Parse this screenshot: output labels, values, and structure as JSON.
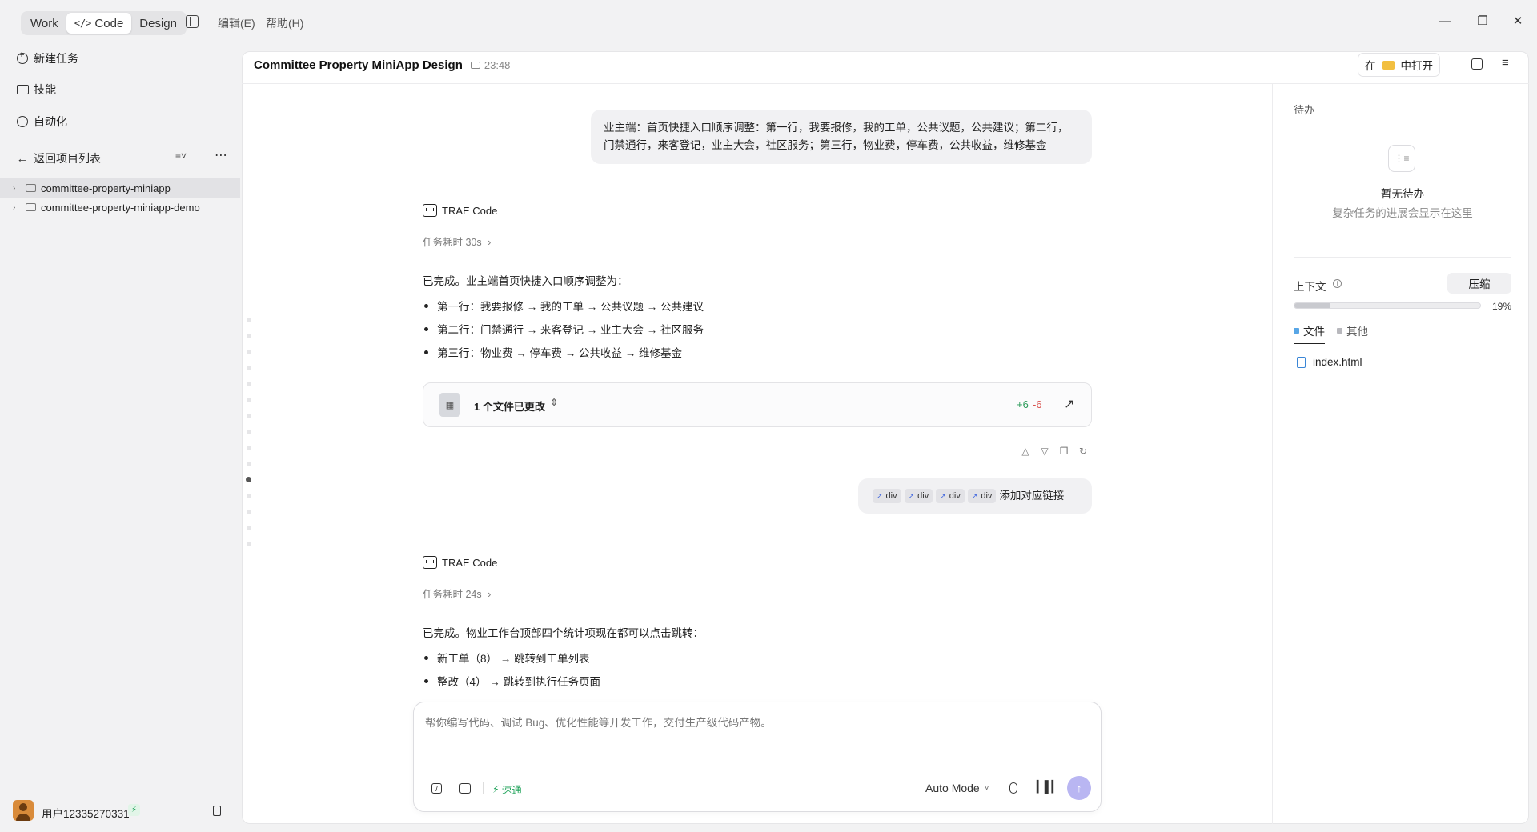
{
  "topbar": {
    "modes": [
      {
        "label": "Work",
        "active": false
      },
      {
        "label": "Code",
        "active": true
      },
      {
        "label": "Design",
        "active": false
      }
    ],
    "menus": [
      "编辑(E)",
      "帮助(H)"
    ]
  },
  "sidebar": {
    "nav": [
      {
        "label": "新建任务",
        "icon": "new-task-icon"
      },
      {
        "label": "技能",
        "icon": "book-icon"
      },
      {
        "label": "自动化",
        "icon": "clock-icon"
      }
    ],
    "back_label": "返回项目列表",
    "projects": [
      {
        "name": "committee-property-miniapp",
        "selected": true
      },
      {
        "name": "committee-property-miniapp-demo",
        "selected": false
      }
    ],
    "user": {
      "name": "用户12335270331",
      "badge": "⚡"
    }
  },
  "header": {
    "title": "Committee Property MiniApp Design",
    "time": "23:48",
    "open_in": {
      "prefix": "在",
      "suffix": "中打开"
    }
  },
  "chat": {
    "msg1": {
      "line1": "业主端：首页快捷入口顺序调整：第一行，我要报修，我的工单，公共议题，公共建议；第二行，",
      "line2": "门禁通行，来客登记，业主大会，社区服务；第三行，物业费，停车费，公共收益，维修基金"
    },
    "reply1": {
      "agent": "TRAE Code",
      "task_time": "任务耗时 30s",
      "summary": "已完成。业主端首页快捷入口顺序调整为：",
      "bullets": [
        "第一行：我要报修 → 我的工单 → 公共议题 → 公共建议",
        "第二行：门禁通行 → 来客登记 → 业主大会 → 社区服务",
        "第三行：物业费 → 停车费 → 公共收益 → 维修基金"
      ],
      "file_change": {
        "label": "1 个文件已更改",
        "added": "+6",
        "removed": "-6"
      }
    },
    "msg2": {
      "chips": [
        "div",
        "div",
        "div",
        "div"
      ],
      "text": "添加对应链接"
    },
    "reply2": {
      "agent": "TRAE Code",
      "task_time": "任务耗时 24s",
      "summary": "已完成。物业工作台顶部四个统计项现在都可以点击跳转：",
      "bullets": [
        "新工单（8） → 跳转到工单列表",
        "整改（4） → 跳转到执行任务页面"
      ]
    }
  },
  "input": {
    "placeholder": "帮你编写代码、调试 Bug、优化性能等开发工作，交付生产级代码产物。",
    "speed_label": "速通",
    "mode_label": "Auto Mode"
  },
  "right_panel": {
    "todo_title": "待办",
    "empty_title": "暂无待办",
    "empty_desc": "复杂任务的进展会显示在这里",
    "context_label": "上下文",
    "compress_label": "压缩",
    "usage_percent": 19,
    "usage_text": "19%",
    "tabs": [
      {
        "label": "文件",
        "active": true
      },
      {
        "label": "其他",
        "active": false
      }
    ],
    "files": [
      "index.html"
    ]
  },
  "colors": {
    "accent": "#b9b6f2",
    "added": "#2e9d5c",
    "removed": "#d9534f",
    "speed": "#20a35a"
  }
}
